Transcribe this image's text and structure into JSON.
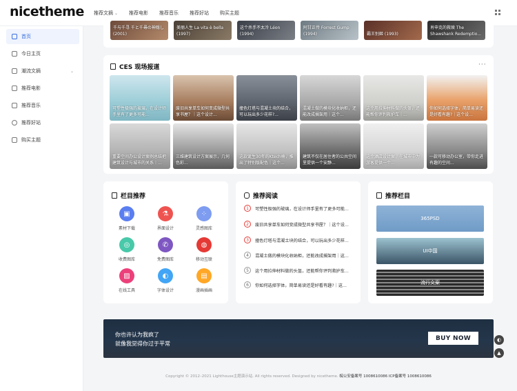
{
  "header": {
    "logo": "nicetheme",
    "nav": [
      {
        "label": "推荐文摘",
        "has_dropdown": true
      },
      {
        "label": "推荐电影"
      },
      {
        "label": "推荐音乐"
      },
      {
        "label": "推荐好站"
      },
      {
        "label": "购买主题"
      }
    ]
  },
  "sidebar": {
    "items": [
      {
        "label": "首页",
        "icon": "home-icon",
        "active": true
      },
      {
        "label": "今日主页",
        "icon": "user-icon"
      },
      {
        "label": "潮流文摘",
        "icon": "article-icon",
        "has_dropdown": true
      },
      {
        "label": "推荐电影",
        "icon": "film-icon"
      },
      {
        "label": "推荐音乐",
        "icon": "music-icon"
      },
      {
        "label": "推荐好站",
        "icon": "globe-icon"
      },
      {
        "label": "购买主题",
        "icon": "cart-icon"
      }
    ]
  },
  "movies_row": [
    {
      "caption": "千与千寻 千と千尋の神隠し (2001)"
    },
    {
      "caption": "美丽人生 La vita è bella (1997)"
    },
    {
      "caption": "这个杀手不太冷 Léon (1994)"
    },
    {
      "caption": "阿甘正传 Forrest Gump (1994)"
    },
    {
      "caption": "霸王别姬 (1993)"
    },
    {
      "caption": "肖申克的救赎 The Shawshank Redemptio..."
    }
  ],
  "ces": {
    "title": "CES 现场报道",
    "more": "···",
    "tiles": [
      {
        "caption": "可塑性极强的玻璃，在设计师手里有了更多可能..."
      },
      {
        "caption": "废旧共享单车如何变成微型共享书屋？｜这个设计..."
      },
      {
        "caption": "撞色灯塔与混凝土块的结合，可以玩出多少花样?..."
      },
      {
        "caption": "混凝土做的模块化收纳柜，还能改成搁架用｜这个..."
      },
      {
        "caption": "这个用拉伸材料做的头盔，还能帮你评判救护车｜..."
      },
      {
        "caption": "你如何选择字体，简单易读还是好看有趣?｜这个设..."
      },
      {
        "caption": "重要空间办公设计案例总结把建筑设计与城市的关系｜..."
      },
      {
        "caption": "三维建筑设计方案展示，几何色彩..."
      },
      {
        "caption": "这款诞生30年的Ktech椅，推出了特别版配色｜这个..."
      },
      {
        "caption": "建筑不仅在居住者的公共空间里提供一个安静..."
      },
      {
        "caption": "这个酒店设计案，在城市中为游客提供一个..."
      },
      {
        "caption": "一款可移动办公室，带你走进有趣的空间..."
      }
    ]
  },
  "columns_recommend": {
    "title": "栏目推荐",
    "items": [
      {
        "label": "素材下载",
        "color": "#5a7ef0",
        "icon": "image-icon"
      },
      {
        "label": "界面设计",
        "color": "#ef5350",
        "icon": "flask-icon"
      },
      {
        "label": "灵感图库",
        "color": "#7e9cf0",
        "icon": "grid-icon"
      },
      {
        "label": "收费图库",
        "color": "#48c9a9",
        "icon": "coin-icon"
      },
      {
        "label": "免费图库",
        "color": "#7e57c2",
        "icon": "phone-icon"
      },
      {
        "label": "移动互联",
        "color": "#e53935",
        "icon": "globe-icon"
      },
      {
        "label": "在线工具",
        "color": "#ec407a",
        "icon": "picture-icon"
      },
      {
        "label": "字体设计",
        "color": "#42a5f5",
        "icon": "gamepad-icon"
      },
      {
        "label": "漫画插画",
        "color": "#ffa726",
        "icon": "book-icon"
      }
    ]
  },
  "recommended_reading": {
    "title": "推荐阅读",
    "items": [
      {
        "num": "1",
        "text": "可塑性极强的玻璃，在设计师手里有了更多可能..."
      },
      {
        "num": "2",
        "text": "废旧共享单车如何变成微型共享书屋？｜这个设..."
      },
      {
        "num": "3",
        "text": "撞色灯塔与混凝土块的结合，可以玩出多少花样..."
      },
      {
        "num": "4",
        "text": "混凝土做的模块化收纳柜，还能改成搁架用｜这..."
      },
      {
        "num": "5",
        "text": "这个用拉伸材料做的头盔，还能帮你评判救护车..."
      },
      {
        "num": "6",
        "text": "你如何选择字体，简单易读还是好看有趣?｜这..."
      }
    ]
  },
  "recommended_columns": {
    "title": "推荐栏目",
    "banners": [
      {
        "label": "365PSD"
      },
      {
        "label": "UI中国"
      },
      {
        "label": "流行文案"
      }
    ]
  },
  "ad": {
    "line1": "你也许认为我疯了",
    "line2": "就像我觉得你过于平常",
    "button": "BUY NOW"
  },
  "footer": {
    "text": "Copyright © 2012–2021 Lighthouse主题演示站. All rights reserved. Designed by nicetheme.",
    "icp": "皖公安备案号 1008610086 ICP备案号 1008610086"
  }
}
